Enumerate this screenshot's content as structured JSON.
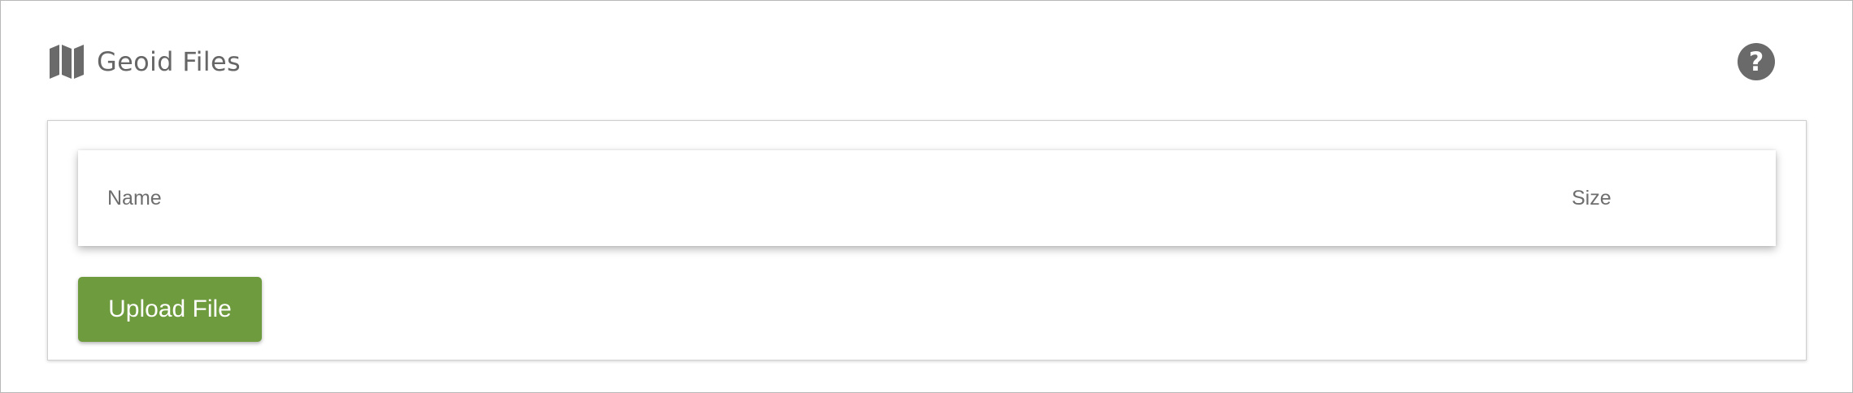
{
  "header": {
    "title": "Geoid Files",
    "icon": "map-icon",
    "help_icon": "help-icon",
    "help_glyph": "?"
  },
  "table": {
    "columns": [
      "Name",
      "Size"
    ],
    "rows": []
  },
  "actions": {
    "upload_label": "Upload File"
  },
  "colors": {
    "accent": "#6f9b3f",
    "icon": "#6a6a6a",
    "text": "#666666"
  }
}
